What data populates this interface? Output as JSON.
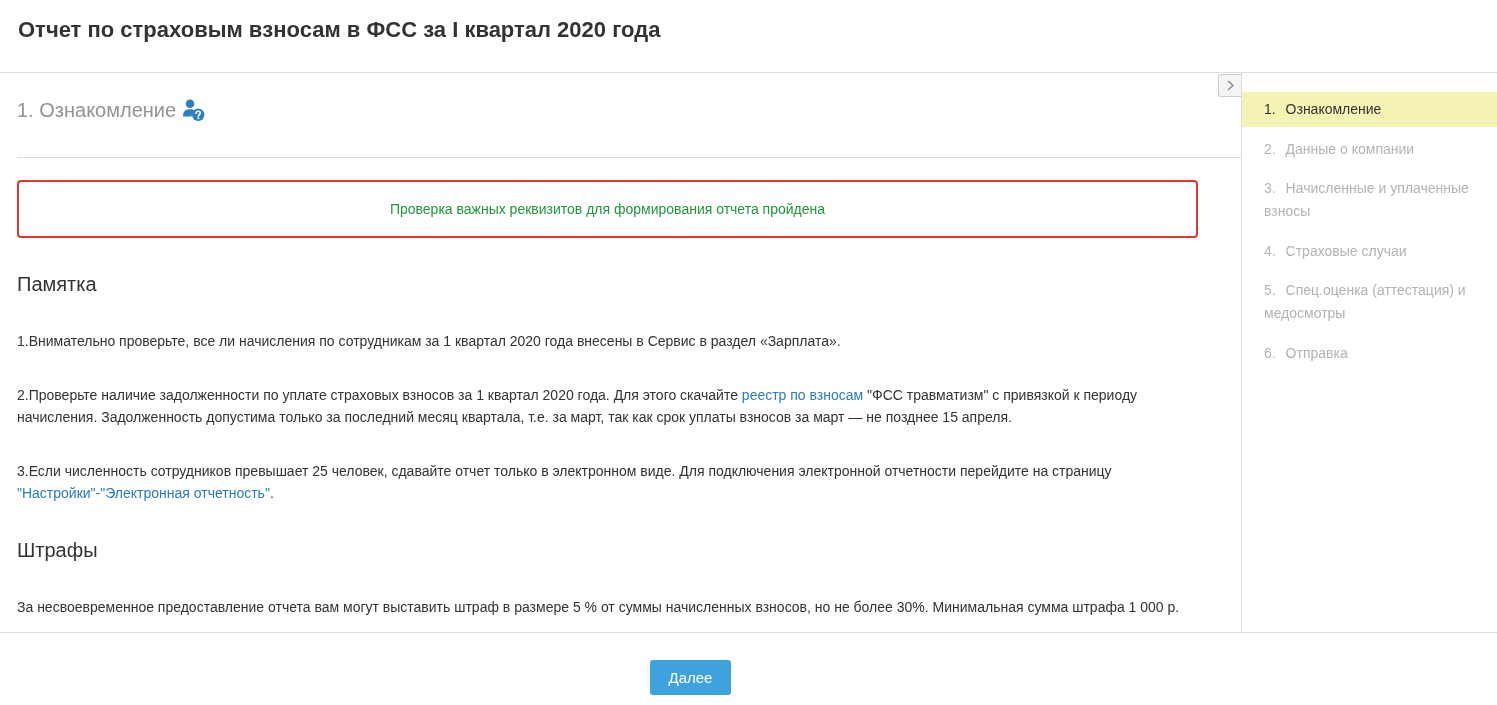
{
  "window": {
    "title": "Отчет по страховым взносам в ФСС за I квартал 2020 года"
  },
  "step": {
    "title": "1. Ознакомление"
  },
  "alert": {
    "text": "Проверка важных реквизитов для формирования отчета пройдена"
  },
  "sections": [
    {
      "heading": "Памятка",
      "paragraphs": [
        [
          {
            "kind": "text",
            "text": "1.Внимательно проверьте, все ли начисления по сотрудникам за 1 квартал 2020 года внесены в Сервис в раздел «Зарплата»."
          }
        ],
        [
          {
            "kind": "text",
            "text": "2.Проверьте наличие задолженности по уплате страховых взносов за 1 квартал 2020 года. Для этого скачайте "
          },
          {
            "kind": "link",
            "text": "реестр по взносам"
          },
          {
            "kind": "text",
            "text": " \"ФСС травматизм\" с привязкой к периоду начисления. Задолженность допустима только за последний месяц квартала, т.е. за март, так как срок уплаты взносов за март — не позднее 15 апреля."
          }
        ],
        [
          {
            "kind": "text",
            "text": "3.Если численность сотрудников превышает 25 человек, сдавайте отчет только в электронном виде. Для подключения электронной отчетности перейдите на страницу "
          },
          {
            "kind": "link",
            "text": "\"Настройки\"-\"Электронная отчетность\""
          },
          {
            "kind": "text",
            "text": "."
          }
        ]
      ]
    },
    {
      "heading": "Штрафы",
      "paragraphs": [
        [
          {
            "kind": "text",
            "text": "За несвоевременное предоставление отчета вам могут выставить штраф в размере 5 % от суммы начисленных взносов, но не более 30%. Минимальная сумма штрафа 1 000 р."
          }
        ]
      ]
    }
  ],
  "sidebar": {
    "items": [
      {
        "number": "1.",
        "label": "Ознакомление",
        "selected": true
      },
      {
        "number": "2.",
        "label": "Данные о компании",
        "selected": false
      },
      {
        "number": "3.",
        "label": "Начисленные и уплаченные взносы",
        "selected": false
      },
      {
        "number": "4.",
        "label": "Страховые случаи",
        "selected": false
      },
      {
        "number": "5.",
        "label": "Спец.оценка (аттестация) и медосмотры",
        "selected": false
      },
      {
        "number": "6.",
        "label": "Отправка",
        "selected": false
      }
    ]
  },
  "footer": {
    "buttons": [
      "Далее"
    ]
  }
}
